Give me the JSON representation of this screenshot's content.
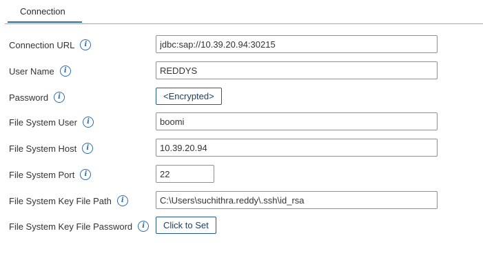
{
  "tabs": [
    {
      "label": "Connection"
    }
  ],
  "fields": {
    "connection_url": {
      "label": "Connection URL",
      "value": "jdbc:sap://10.39.20.94:30215"
    },
    "user_name": {
      "label": "User Name",
      "value": "REDDYS"
    },
    "password": {
      "label": "Password",
      "button_label": "<Encrypted>"
    },
    "fs_user": {
      "label": "File System User",
      "value": "boomi"
    },
    "fs_host": {
      "label": "File System Host",
      "value": "10.39.20.94"
    },
    "fs_port": {
      "label": "File System Port",
      "value": "22"
    },
    "fs_key_path": {
      "label": "File System Key File Path",
      "value": "C:\\Users\\suchithra.reddy\\.ssh\\id_rsa"
    },
    "fs_key_password": {
      "label": "File System Key File Password",
      "button_label": "Click to Set"
    }
  },
  "info_icon_glyph": "i",
  "colors": {
    "accent": "#2a6bb5",
    "input_border": "#8f8f8f",
    "button_border": "#1f5a99",
    "tab_rule": "#9fa7af"
  }
}
